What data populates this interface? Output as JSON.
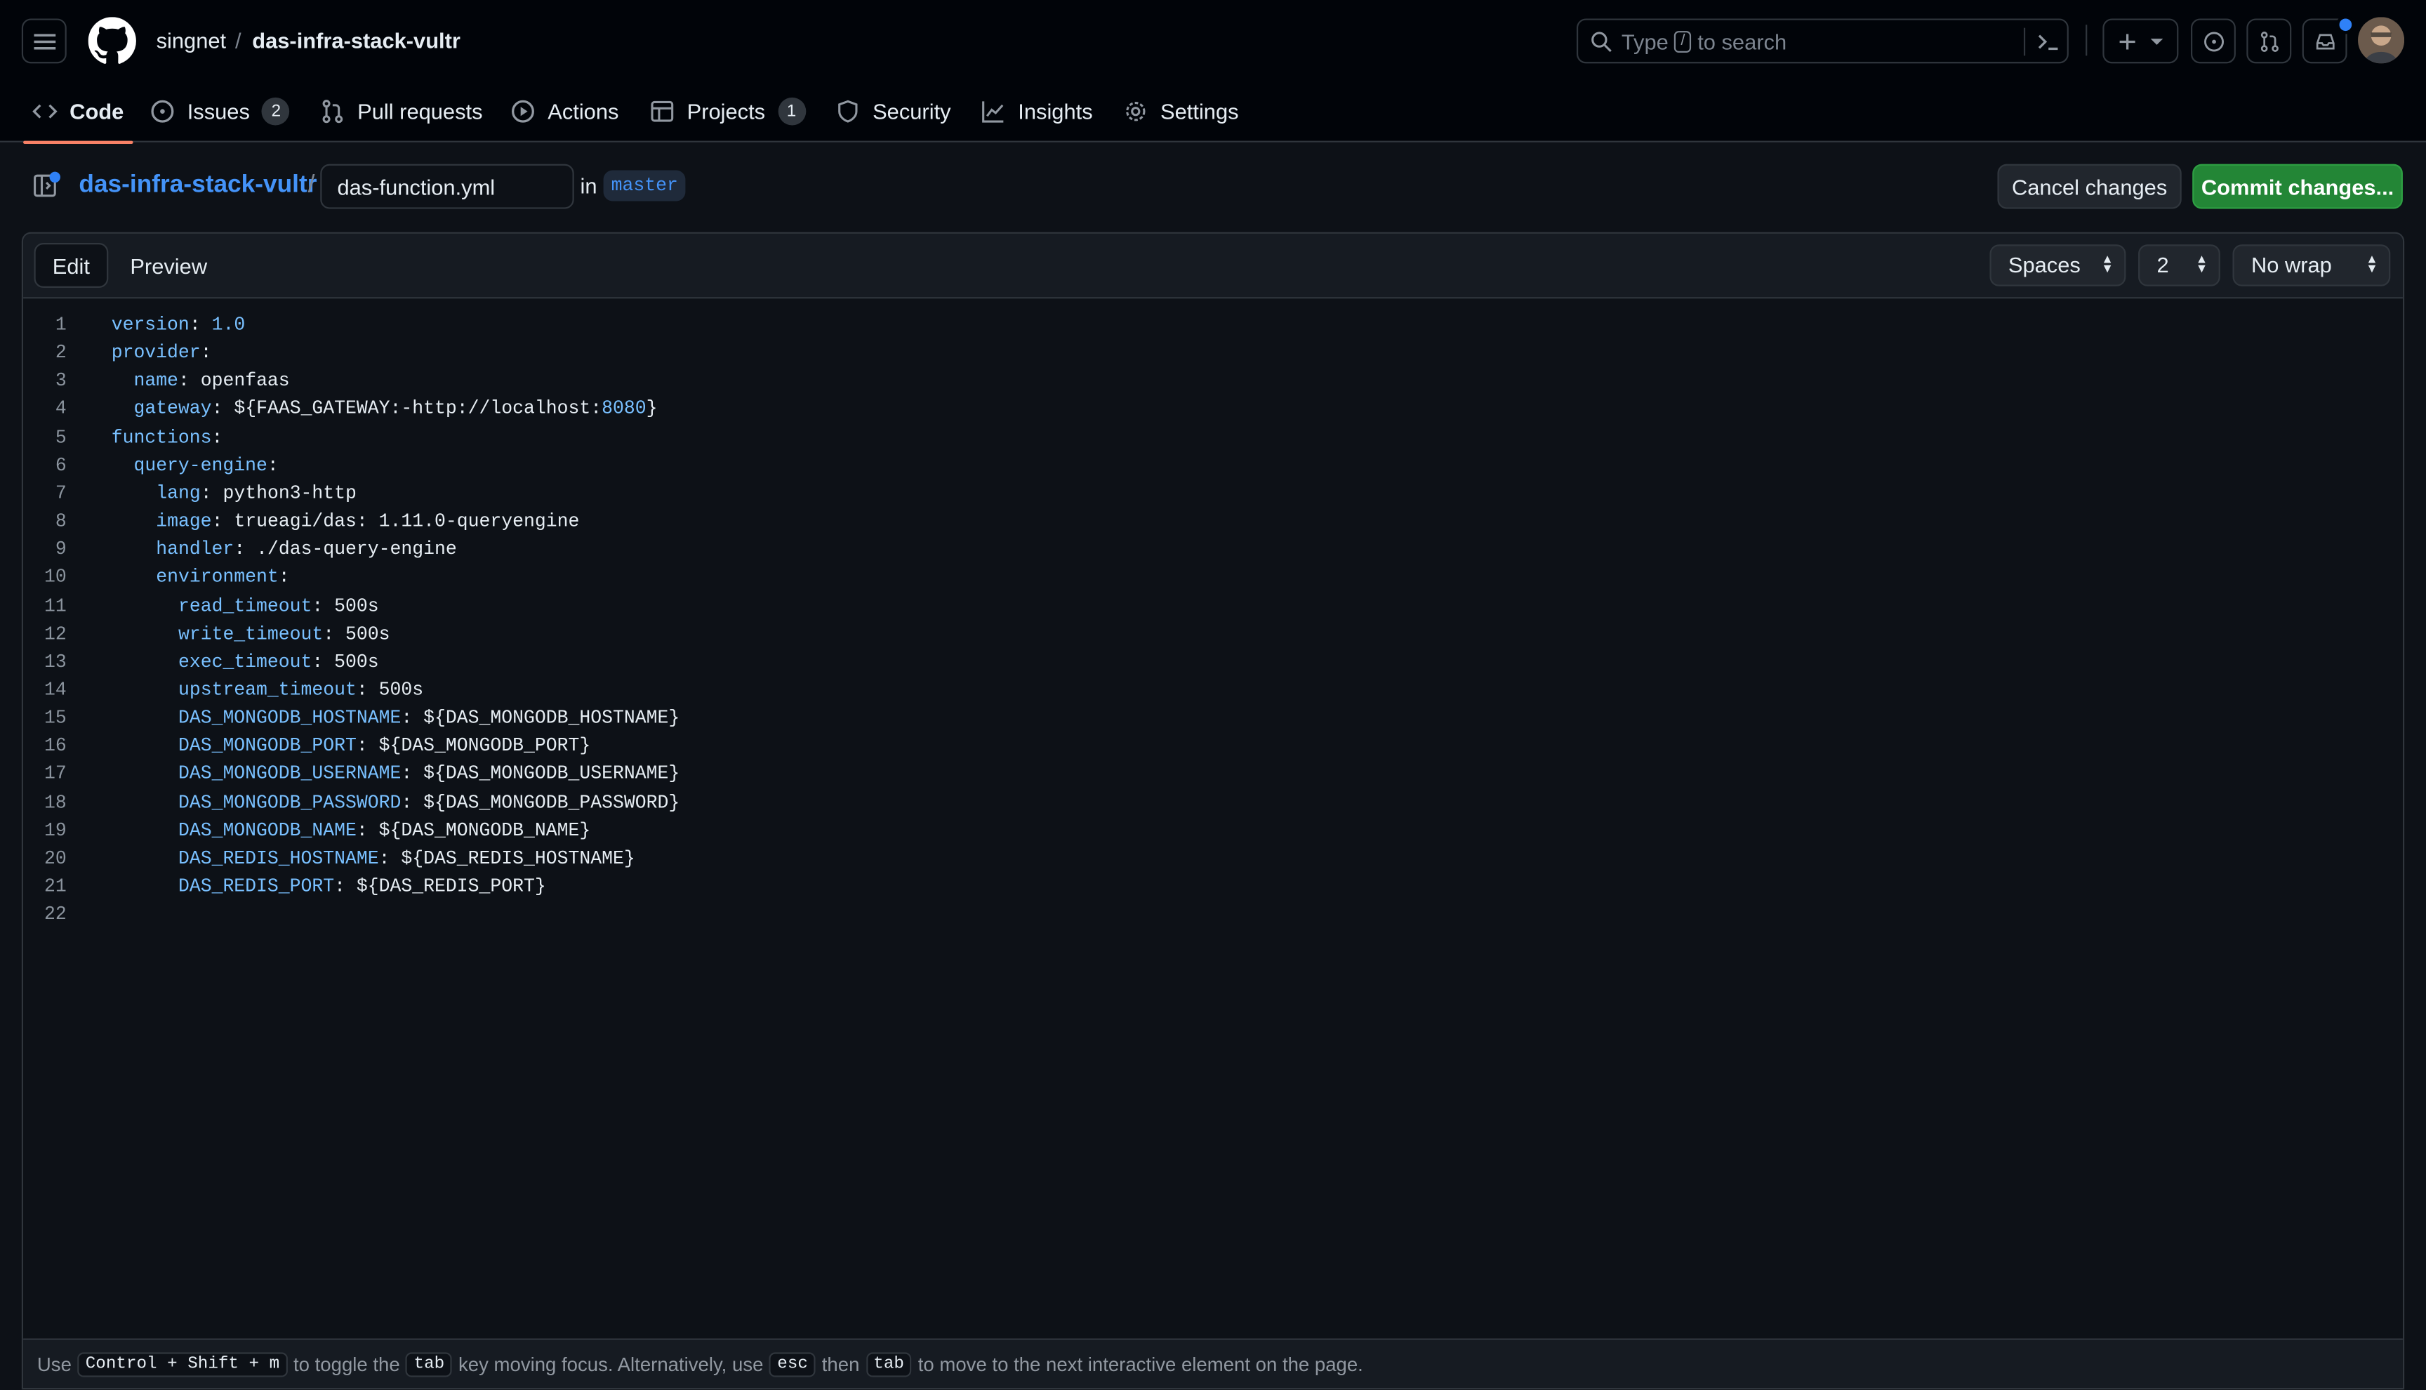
{
  "header": {
    "owner": "singnet",
    "separator": "/",
    "repo": "das-infra-stack-vultr",
    "search_prefix": "Type",
    "search_key": "/",
    "search_suffix": "to search"
  },
  "nav": {
    "tabs": [
      {
        "label": "Code",
        "icon": "code-icon",
        "active": true
      },
      {
        "label": "Issues",
        "icon": "issue-icon",
        "count": "2"
      },
      {
        "label": "Pull requests",
        "icon": "pull-request-icon"
      },
      {
        "label": "Actions",
        "icon": "play-icon"
      },
      {
        "label": "Projects",
        "icon": "table-icon",
        "count": "1"
      },
      {
        "label": "Security",
        "icon": "shield-icon"
      },
      {
        "label": "Insights",
        "icon": "graph-icon"
      },
      {
        "label": "Settings",
        "icon": "gear-icon"
      }
    ]
  },
  "file": {
    "repo_link": "das-infra-stack-vultr",
    "slash": "/",
    "filename": "das-function.yml",
    "in_label": "in",
    "branch": "master",
    "cancel_label": "Cancel changes",
    "commit_label": "Commit changes..."
  },
  "editor": {
    "edit_tab": "Edit",
    "preview_tab": "Preview",
    "indent_mode": "Spaces",
    "indent_size": "2",
    "wrap_mode": "No wrap",
    "lines": [
      {
        "num": "1",
        "indent": "",
        "key": "version",
        "sep": ": ",
        "val": "",
        "num_val": "1.0"
      },
      {
        "num": "2",
        "indent": "",
        "key": "provider",
        "sep": ":",
        "val": ""
      },
      {
        "num": "3",
        "indent": "  ",
        "key": "name",
        "sep": ": ",
        "val": "openfaas"
      },
      {
        "num": "4",
        "indent": "  ",
        "key": "gateway",
        "sep": ": ",
        "val": "${FAAS_GATEWAY:-http://localhost:",
        "num_val": "8080",
        "tail": "}"
      },
      {
        "num": "5",
        "indent": "",
        "key": "functions",
        "sep": ":",
        "val": ""
      },
      {
        "num": "6",
        "indent": "  ",
        "key": "query-engine",
        "sep": ":",
        "val": ""
      },
      {
        "num": "7",
        "indent": "    ",
        "key": "lang",
        "sep": ": ",
        "val": "python3-http"
      },
      {
        "num": "8",
        "indent": "    ",
        "key": "image",
        "sep": ": ",
        "val": "trueagi/das: 1.11.0-queryengine"
      },
      {
        "num": "9",
        "indent": "    ",
        "key": "handler",
        "sep": ": ",
        "val": "./das-query-engine"
      },
      {
        "num": "10",
        "indent": "    ",
        "key": "environment",
        "sep": ":",
        "val": ""
      },
      {
        "num": "11",
        "indent": "      ",
        "key": "read_timeout",
        "sep": ": ",
        "val": "500s"
      },
      {
        "num": "12",
        "indent": "      ",
        "key": "write_timeout",
        "sep": ": ",
        "val": "500s"
      },
      {
        "num": "13",
        "indent": "      ",
        "key": "exec_timeout",
        "sep": ": ",
        "val": "500s"
      },
      {
        "num": "14",
        "indent": "      ",
        "key": "upstream_timeout",
        "sep": ": ",
        "val": "500s"
      },
      {
        "num": "15",
        "indent": "      ",
        "key": "DAS_MONGODB_HOSTNAME",
        "sep": ": ",
        "val": "${DAS_MONGODB_HOSTNAME}"
      },
      {
        "num": "16",
        "indent": "      ",
        "key": "DAS_MONGODB_PORT",
        "sep": ": ",
        "val": "${DAS_MONGODB_PORT}"
      },
      {
        "num": "17",
        "indent": "      ",
        "key": "DAS_MONGODB_USERNAME",
        "sep": ": ",
        "val": "${DAS_MONGODB_USERNAME}"
      },
      {
        "num": "18",
        "indent": "      ",
        "key": "DAS_MONGODB_PASSWORD",
        "sep": ": ",
        "val": "${DAS_MONGODB_PASSWORD}"
      },
      {
        "num": "19",
        "indent": "      ",
        "key": "DAS_MONGODB_NAME",
        "sep": ": ",
        "val": "${DAS_MONGODB_NAME}"
      },
      {
        "num": "20",
        "indent": "      ",
        "key": "DAS_REDIS_HOSTNAME",
        "sep": ": ",
        "val": "${DAS_REDIS_HOSTNAME}"
      },
      {
        "num": "21",
        "indent": "      ",
        "key": "DAS_REDIS_PORT",
        "sep": ": ",
        "val": "${DAS_REDIS_PORT}"
      },
      {
        "num": "22",
        "indent": "",
        "key": "",
        "sep": "",
        "val": ""
      }
    ]
  },
  "footer": {
    "t1": "Use",
    "k1": "Control + Shift + m",
    "t2": "to toggle the",
    "k2": "tab",
    "t3": "key moving focus. Alternatively, use",
    "k3": "esc",
    "t4": "then",
    "k4": "tab",
    "t5": "to move to the next interactive element on the page."
  },
  "colors": {
    "accent": "#f78166",
    "commit": "#238636",
    "link": "#4493f8",
    "key": "#79c0ff"
  }
}
